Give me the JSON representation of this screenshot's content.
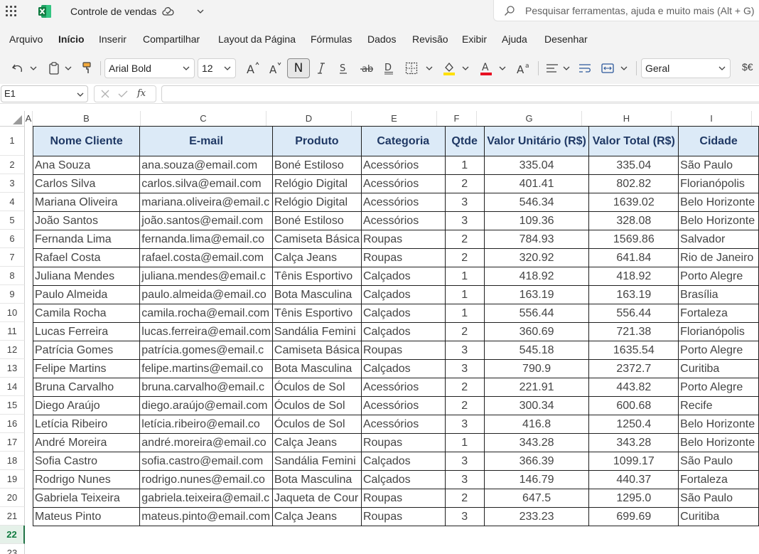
{
  "app": {
    "title": "Controle de vendas",
    "search_placeholder": "Pesquisar ferramentas, ajuda e muito mais (Alt + G)"
  },
  "menu": {
    "items": [
      "Arquivo",
      "Início",
      "Inserir",
      "Compartilhar",
      "Layout da Página",
      "Fórmulas",
      "Dados",
      "Revisão",
      "Exibir",
      "Ajuda",
      "Desenhar"
    ],
    "active": "Início"
  },
  "ribbon": {
    "font_name": "Arial Bold",
    "font_size": "12",
    "number_format": "Geral",
    "bold_label": "N",
    "currency_label": "$€"
  },
  "formula_bar": {
    "name_box": "E1",
    "fx_label": "fx",
    "formula": ""
  },
  "grid": {
    "column_letters": [
      "A",
      "B",
      "C",
      "D",
      "E",
      "F",
      "G",
      "H",
      "I"
    ],
    "row_numbers": [
      "1",
      "2",
      "3",
      "4",
      "5",
      "6",
      "7",
      "8",
      "9",
      "10",
      "11",
      "12",
      "13",
      "14",
      "15",
      "16",
      "17",
      "18",
      "19",
      "20",
      "21",
      "22",
      "23"
    ],
    "selected_row": "22"
  },
  "table": {
    "headers": [
      "Nome Cliente",
      "E-mail",
      "Produto",
      "Categoria",
      "Qtde",
      "Valor Unitário (R$)",
      "Valor Total (R$)",
      "Cidade"
    ],
    "rows": [
      [
        "Ana Souza",
        "ana.souza@email.com",
        "Boné Estiloso",
        "Acessórios",
        "1",
        "335.04",
        "335.04",
        "São Paulo"
      ],
      [
        "Carlos Silva",
        "carlos.silva@email.com",
        "Relógio Digital",
        "Acessórios",
        "2",
        "401.41",
        "802.82",
        "Florianópolis"
      ],
      [
        "Mariana Oliveira",
        "mariana.oliveira@email.c",
        "Relógio Digital",
        "Acessórios",
        "3",
        "546.34",
        "1639.02",
        "Belo Horizonte"
      ],
      [
        "João Santos",
        "joão.santos@email.com",
        "Boné Estiloso",
        "Acessórios",
        "3",
        "109.36",
        "328.08",
        "Belo Horizonte"
      ],
      [
        "Fernanda Lima",
        "fernanda.lima@email.co",
        "Camiseta Básica",
        "Roupas",
        "2",
        "784.93",
        "1569.86",
        "Salvador"
      ],
      [
        "Rafael Costa",
        "rafael.costa@email.com",
        "Calça Jeans",
        "Roupas",
        "2",
        "320.92",
        "641.84",
        "Rio de Janeiro"
      ],
      [
        "Juliana Mendes",
        "juliana.mendes@email.c",
        "Tênis Esportivo",
        "Calçados",
        "1",
        "418.92",
        "418.92",
        "Porto Alegre"
      ],
      [
        "Paulo Almeida",
        "paulo.almeida@email.co",
        "Bota Masculina",
        "Calçados",
        "1",
        "163.19",
        "163.19",
        "Brasília"
      ],
      [
        "Camila Rocha",
        "camila.rocha@email.com",
        "Tênis Esportivo",
        "Calçados",
        "1",
        "556.44",
        "556.44",
        "Fortaleza"
      ],
      [
        "Lucas Ferreira",
        "lucas.ferreira@email.com",
        "Sandália Femini",
        "Calçados",
        "2",
        "360.69",
        "721.38",
        "Florianópolis"
      ],
      [
        "Patrícia Gomes",
        "patrícia.gomes@email.c",
        "Camiseta Básica",
        "Roupas",
        "3",
        "545.18",
        "1635.54",
        "Porto Alegre"
      ],
      [
        "Felipe Martins",
        "felipe.martins@email.co",
        "Bota Masculina",
        "Calçados",
        "3",
        "790.9",
        "2372.7",
        "Curitiba"
      ],
      [
        "Bruna Carvalho",
        "bruna.carvalho@email.c",
        "Óculos de Sol",
        "Acessórios",
        "2",
        "221.91",
        "443.82",
        "Porto Alegre"
      ],
      [
        "Diego Araújo",
        "diego.araújo@email.com",
        "Óculos de Sol",
        "Acessórios",
        "2",
        "300.34",
        "600.68",
        "Recife"
      ],
      [
        "Letícia Ribeiro",
        "letícia.ribeiro@email.co",
        "Óculos de Sol",
        "Acessórios",
        "3",
        "416.8",
        "1250.4",
        "Belo Horizonte"
      ],
      [
        "André Moreira",
        "andré.moreira@email.co",
        "Calça Jeans",
        "Roupas",
        "1",
        "343.28",
        "343.28",
        "Belo Horizonte"
      ],
      [
        "Sofia Castro",
        "sofia.castro@email.com",
        "Sandália Femini",
        "Calçados",
        "3",
        "366.39",
        "1099.17",
        "São Paulo"
      ],
      [
        "Rodrigo Nunes",
        "rodrigo.nunes@email.co",
        "Bota Masculina",
        "Calçados",
        "3",
        "146.79",
        "440.37",
        "Fortaleza"
      ],
      [
        "Gabriela Teixeira",
        "gabriela.teixeira@email.c",
        "Jaqueta de Cour",
        "Roupas",
        "2",
        "647.5",
        "1295.0",
        "São Paulo"
      ],
      [
        "Mateus Pinto",
        "mateus.pinto@email.com",
        "Calça Jeans",
        "Roupas",
        "3",
        "233.23",
        "699.69",
        "Curitiba"
      ]
    ]
  },
  "colors": {
    "header_fill": "#dceaf7",
    "header_text": "#1f3864",
    "excel_green": "#217346"
  }
}
